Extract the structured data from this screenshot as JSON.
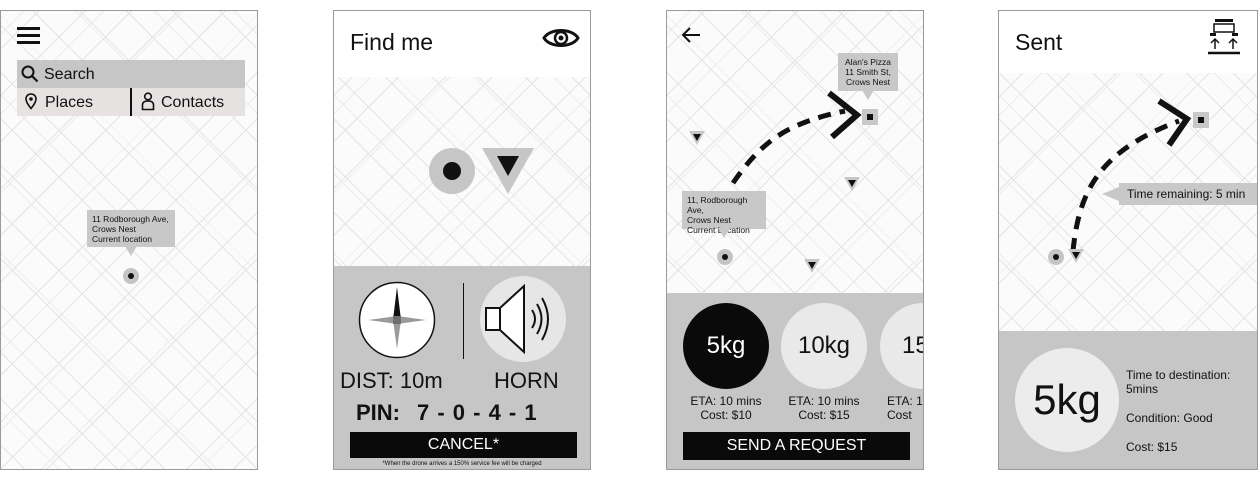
{
  "screen1": {
    "search": "Search",
    "places": "Places",
    "contacts": "Contacts",
    "callout": [
      "11 Rodborough Ave,",
      "Crows Nest",
      "Current location"
    ]
  },
  "screen2": {
    "title": "Find me",
    "dist": "DIST: 10m",
    "horn": "HORN",
    "pin_label": "PIN:",
    "pin_digits": "7 - 0 - 4 - 1",
    "cancel": "CANCEL*",
    "footnote": "*When the drone arrives a 150% service fee will be charged"
  },
  "screen3": {
    "dest_callout": [
      "Alan's Pizza",
      "11 Smith St,",
      "Crows Nest"
    ],
    "loc_callout": [
      "11, Rodborough Ave,",
      "Crows Nest",
      "Current Location"
    ],
    "options": [
      {
        "weight": "5kg",
        "eta": "ETA: 10 mins",
        "cost": "Cost: $10"
      },
      {
        "weight": "10kg",
        "eta": "ETA: 10 mins",
        "cost": "Cost: $15"
      },
      {
        "weight": "15",
        "eta": "ETA: 1(",
        "cost": "Cost"
      }
    ],
    "send": "SEND A REQUEST"
  },
  "screen4": {
    "title": "Sent",
    "time_remaining": "Time remaining: 5 min",
    "weight": "5kg",
    "time_to_dest_label": "Time to destination:",
    "time_to_dest_value": "5mins",
    "condition": "Condition: Good",
    "cost": "Cost: $15"
  }
}
